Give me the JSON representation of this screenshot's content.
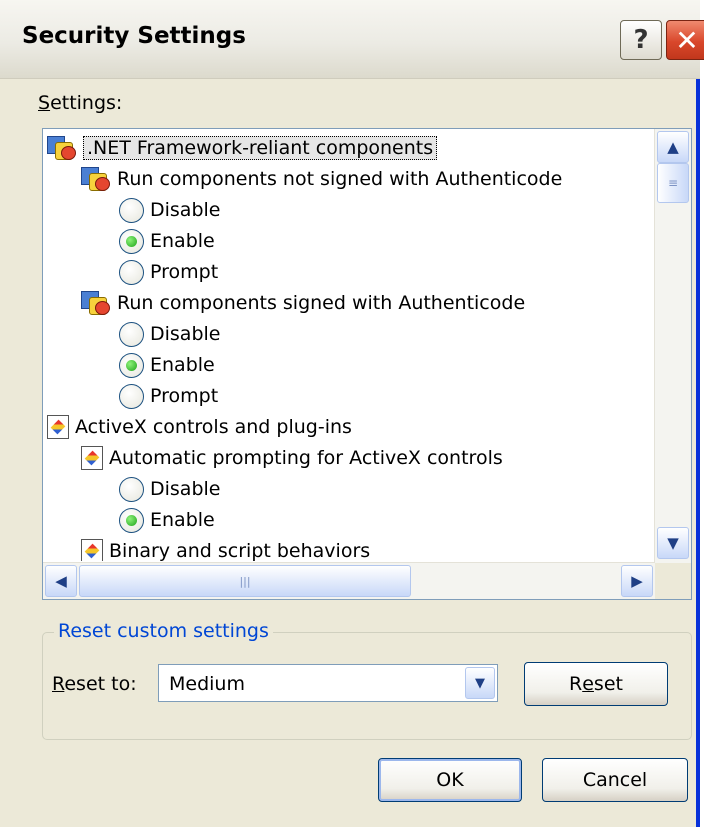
{
  "window": {
    "title": "Security Settings",
    "help_glyph": "?",
    "close_glyph": "✕"
  },
  "settings_label": {
    "accel": "S",
    "rest": "ettings:"
  },
  "tree": {
    "rows": [
      {
        "text": ".NET Framework-reliant components",
        "kind": "category",
        "icon": "dotnet-components-icon",
        "selected": true
      },
      {
        "text": "Run components not signed with Authenticode",
        "kind": "setting",
        "icon": "dotnet-components-icon"
      },
      {
        "text": "Disable",
        "kind": "option",
        "checked": false
      },
      {
        "text": "Enable",
        "kind": "option",
        "checked": true
      },
      {
        "text": "Prompt",
        "kind": "option",
        "checked": false
      },
      {
        "text": "Run components signed with Authenticode",
        "kind": "setting",
        "icon": "dotnet-components-icon"
      },
      {
        "text": "Disable",
        "kind": "option",
        "checked": false
      },
      {
        "text": "Enable",
        "kind": "option",
        "checked": true
      },
      {
        "text": "Prompt",
        "kind": "option",
        "checked": false
      },
      {
        "text": "ActiveX controls and plug-ins",
        "kind": "category",
        "icon": "activex-icon"
      },
      {
        "text": "Automatic prompting for ActiveX controls",
        "kind": "setting",
        "icon": "activex-icon"
      },
      {
        "text": "Disable",
        "kind": "option",
        "checked": false
      },
      {
        "text": "Enable",
        "kind": "option",
        "checked": true
      },
      {
        "text": "Binary and script behaviors",
        "kind": "setting",
        "icon": "activex-icon"
      }
    ]
  },
  "reset_group": {
    "legend": "Reset custom settings",
    "reset_to_label": {
      "accel": "R",
      "rest": "eset to:"
    },
    "selected_value": "Medium",
    "reset_button": {
      "before": "R",
      "accel": "e",
      "after": "set"
    }
  },
  "buttons": {
    "ok": "OK",
    "cancel": "Cancel"
  },
  "colors": {
    "window_bg": "#ece9d8",
    "legend_text": "#0046d5",
    "frame_blue": "#0831d9",
    "close_red": "#d9472b"
  }
}
